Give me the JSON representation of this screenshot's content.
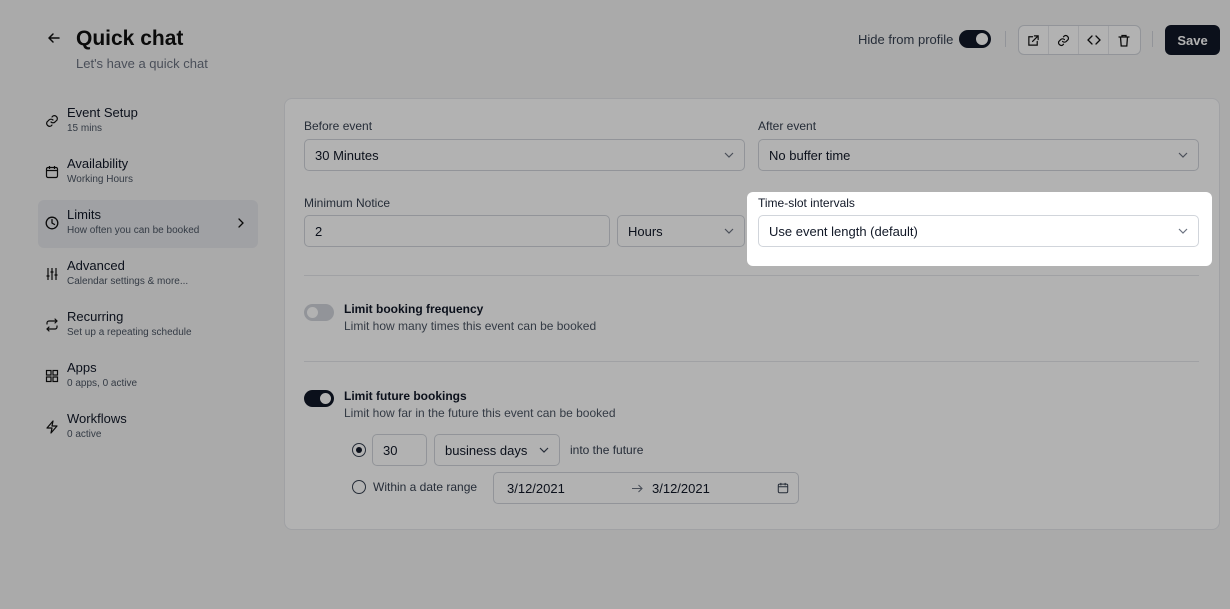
{
  "header": {
    "title": "Quick chat",
    "subtitle": "Let's have a quick chat",
    "hide_from_profile_label": "Hide from profile",
    "hide_from_profile_on": true,
    "save_label": "Save",
    "icons": [
      "external-link-icon",
      "link-icon",
      "code-icon",
      "trash-icon"
    ]
  },
  "sidebar": {
    "items": [
      {
        "title": "Event Setup",
        "sub": "15 mins",
        "icon": "link-icon"
      },
      {
        "title": "Availability",
        "sub": "Working Hours",
        "icon": "calendar-icon"
      },
      {
        "title": "Limits",
        "sub": "How often you can be booked",
        "icon": "clock-icon",
        "active": true
      },
      {
        "title": "Advanced",
        "sub": "Calendar settings & more...",
        "icon": "sliders-icon"
      },
      {
        "title": "Recurring",
        "sub": "Set up a repeating schedule",
        "icon": "repeat-icon"
      },
      {
        "title": "Apps",
        "sub": "0 apps, 0 active",
        "icon": "grid-icon"
      },
      {
        "title": "Workflows",
        "sub": "0 active",
        "icon": "zap-icon"
      }
    ]
  },
  "limits": {
    "before_event": {
      "label": "Before event",
      "value": "30 Minutes"
    },
    "after_event": {
      "label": "After event",
      "value": "No buffer time"
    },
    "minimum_notice": {
      "label": "Minimum Notice",
      "value": "2",
      "unit": "Hours"
    },
    "time_slot": {
      "label": "Time-slot intervals",
      "value": "Use event length (default)"
    },
    "booking_frequency": {
      "title": "Limit booking frequency",
      "desc": "Limit how many times this event can be booked",
      "enabled": false
    },
    "future_bookings": {
      "title": "Limit future bookings",
      "desc": "Limit how far in the future this event can be booked",
      "enabled": true,
      "days_value": "30",
      "days_unit": "business days",
      "into_future": "into the future",
      "range_label": "Within a date range",
      "range_start": "3/12/2021",
      "range_end": "3/12/2021",
      "selected": "days"
    }
  }
}
